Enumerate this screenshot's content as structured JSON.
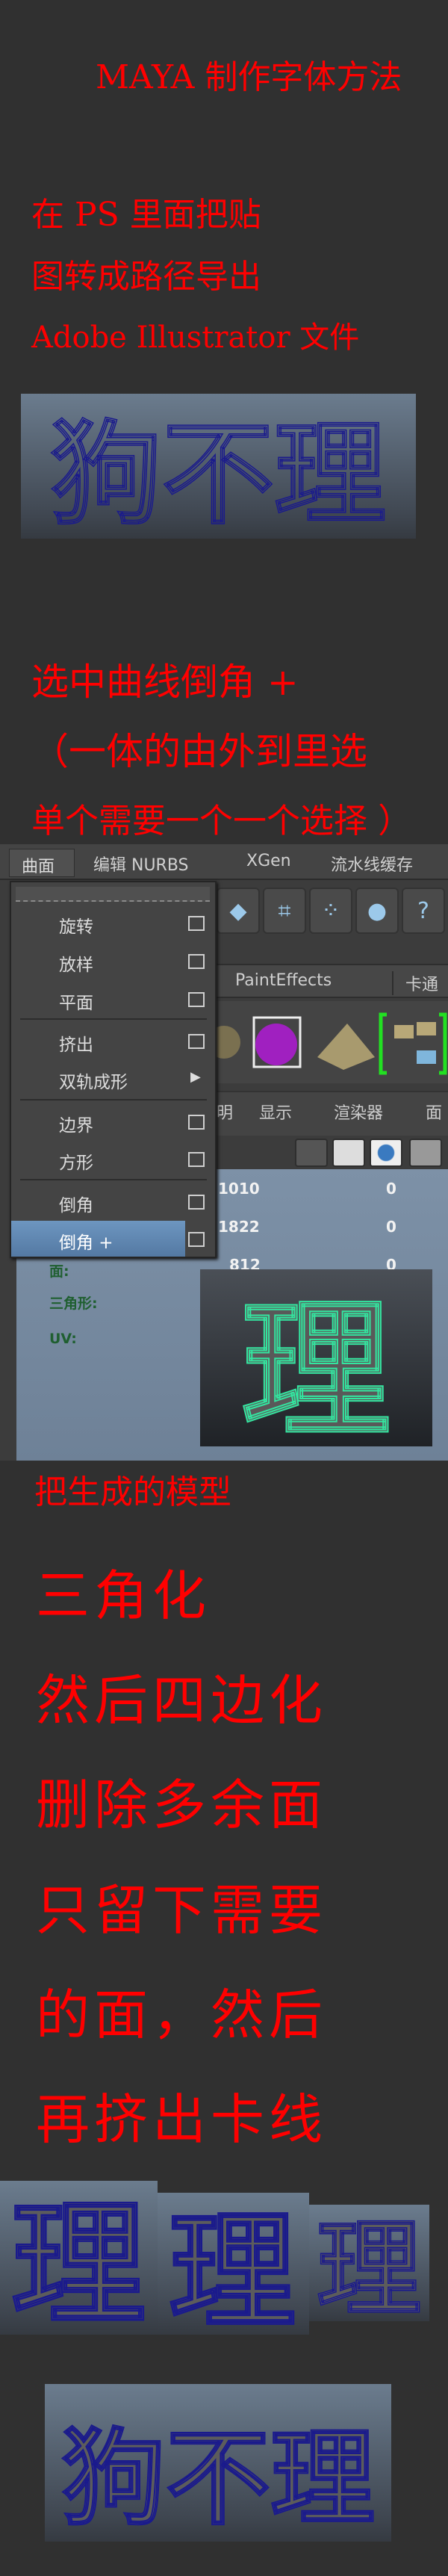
{
  "title": "MAYA 制作字体方法",
  "step1": {
    "lines": [
      "在 PS 里面把贴",
      "图转成路径导出",
      "Adobe Illustrator 文件"
    ]
  },
  "step2": {
    "lines": [
      "选中曲线倒角 +",
      "（一体的由外到里选",
      "单个需要一个一个选择 ）"
    ]
  },
  "step3": {
    "lines": [
      "把生成的模型"
    ]
  },
  "step4": {
    "lines": [
      "三角化",
      "然后四边化",
      "删除多余面",
      "只留下需要",
      "的面，然后",
      "再挤出卡线"
    ]
  },
  "model_text": "狗不理",
  "model_char": "理",
  "maya": {
    "menubar": [
      "曲面",
      "编辑 NURBS",
      "XGen",
      "流水线缓存"
    ],
    "shelf_tabs": [
      "PaintEffects",
      "卡通"
    ],
    "panel_menu": [
      "明",
      "显示",
      "渲染器",
      "面"
    ],
    "dropdown": [
      {
        "label": "旋转",
        "option_box": true
      },
      {
        "label": "放样",
        "option_box": true
      },
      {
        "label": "平面",
        "option_box": true
      },
      {
        "label": "挤出",
        "option_box": true
      },
      {
        "label": "双轨成形",
        "submenu": true
      },
      {
        "label": "边界",
        "option_box": true
      },
      {
        "label": "方形",
        "option_box": true
      },
      {
        "label": "倒角",
        "option_box": true
      },
      {
        "label": "倒角 +",
        "option_box": true,
        "highlighted": true
      }
    ],
    "stats": {
      "rows": [
        [
          "1010",
          "0"
        ],
        [
          "1822",
          "0"
        ],
        [
          "812",
          "0"
        ]
      ],
      "labels": [
        "面:",
        "三角形:",
        "UV:"
      ]
    }
  },
  "colors": {
    "text": "#ff0000",
    "background": "#303030",
    "menu_highlight": "#5f87b2",
    "wire_green": "#33e6a0",
    "wire_blue": "#1a1a8c"
  }
}
